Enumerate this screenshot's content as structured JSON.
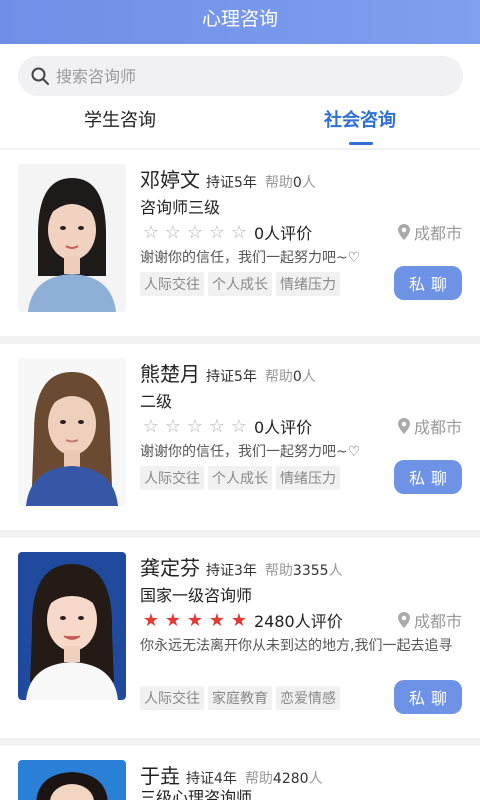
{
  "header": {
    "title": "心理咨询"
  },
  "search": {
    "placeholder": "搜索咨询师"
  },
  "tabs": [
    {
      "label": "学生咨询"
    },
    {
      "label": "社会咨询"
    }
  ],
  "colors": {
    "accent": "#2e6fd8",
    "header": "#7696ec",
    "button": "#6e93e6",
    "star_filled": "#e53935",
    "star_empty": "#b5b5b5"
  },
  "counselors": [
    {
      "name": "邓婷文",
      "cert": "持证5年",
      "help_prefix": "帮助",
      "help_count": "0",
      "help_suffix": "人",
      "level": "咨询师三级",
      "rating": 0,
      "reviews": "0人评价",
      "city": "成都市",
      "motto": "谢谢你的信任，我们一起努力吧~♡",
      "tags": [
        "人际交往",
        "个人成长",
        "情绪压力"
      ],
      "button": "私聊"
    },
    {
      "name": "熊楚月",
      "cert": "持证5年",
      "help_prefix": "帮助",
      "help_count": "0",
      "help_suffix": "人",
      "level": "二级",
      "rating": 0,
      "reviews": "0人评价",
      "city": "成都市",
      "motto": "谢谢你的信任，我们一起努力吧~♡",
      "tags": [
        "人际交往",
        "个人成长",
        "情绪压力"
      ],
      "button": "私聊"
    },
    {
      "name": "龚定芬",
      "cert": "持证3年",
      "help_prefix": "帮助",
      "help_count": "3355",
      "help_suffix": "人",
      "level": "国家一级咨询师",
      "rating": 5,
      "reviews": "2480人评价",
      "city": "成都市",
      "motto": "你永远无法离开你从未到达的地方,我们一起去追寻",
      "tags": [
        "人际交往",
        "家庭教育",
        "恋爱情感"
      ],
      "button": "私聊"
    },
    {
      "name": "于垚",
      "cert": "持证4年",
      "help_prefix": "帮助",
      "help_count": "4280",
      "help_suffix": "人",
      "level": "三级心理咨询师"
    }
  ]
}
